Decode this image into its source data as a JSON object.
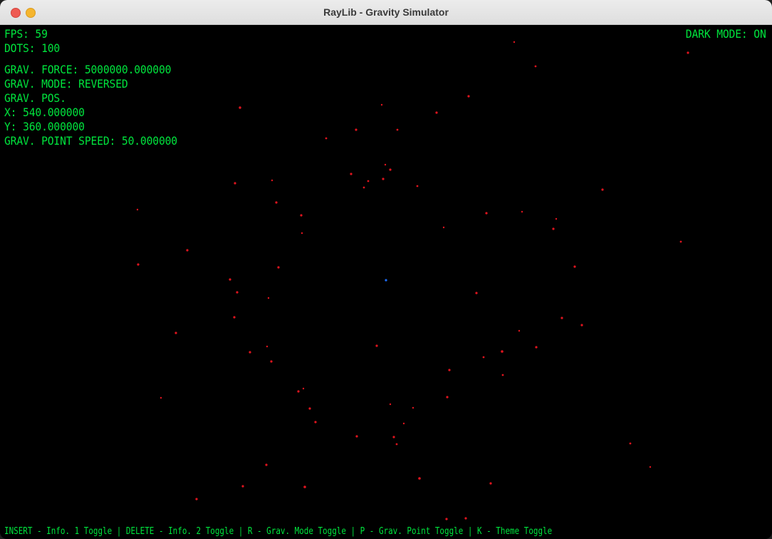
{
  "window": {
    "title": "RayLib - Gravity Simulator"
  },
  "hud": {
    "fps": "FPS: 59",
    "dots": "DOTS: 100",
    "grav_force": "GRAV. FORCE: 5000000.000000",
    "grav_mode": "GRAV. MODE: REVERSED",
    "grav_pos": "GRAV. POS.",
    "x": "X: 540.000000",
    "y": "Y: 360.000000",
    "grav_speed": "GRAV. POINT SPEED: 50.000000",
    "dark_mode": "DARK MODE: ON"
  },
  "footer": {
    "help": "INSERT - Info. 1 Toggle | DELETE - Info. 2 Toggle | R - Grav. Mode Toggle | P - Grav. Point Toggle | K - Theme Toggle"
  },
  "colors": {
    "hud_text": "#00e43d",
    "dot": "#e0141e",
    "gravity_point": "#1e6fff",
    "background": "#000000"
  }
}
